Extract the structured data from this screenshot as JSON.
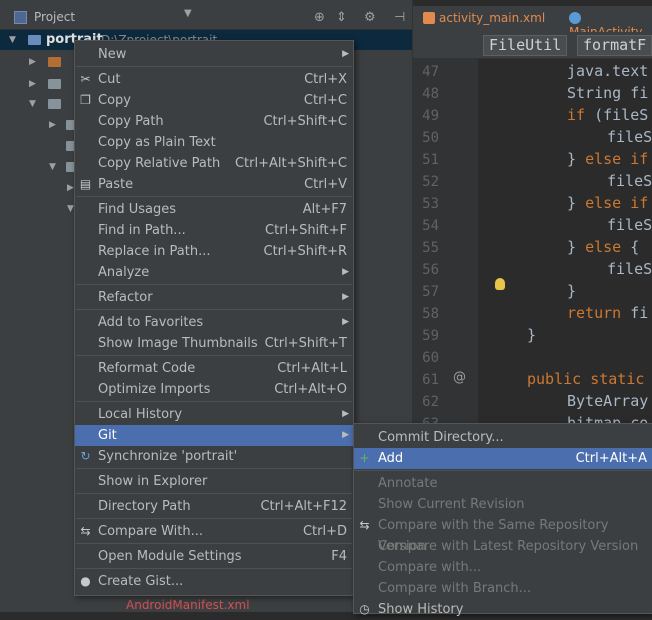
{
  "project_panel": {
    "title": "Project",
    "root": {
      "name": "portrait",
      "path": "D:\\Zproject\\portrait"
    },
    "manifest_file": "AndroidManifest.xml"
  },
  "editor": {
    "tabs": [
      {
        "label": "activity_main.xml",
        "color": "#e08b4d"
      },
      {
        "label": "MainActivity",
        "color": "#5b9bd5"
      }
    ],
    "breadcrumbs": [
      "FileUtil",
      "formatF"
    ],
    "lines": [
      {
        "num": "47",
        "indent": 1,
        "text": "java.text"
      },
      {
        "num": "48",
        "indent": 1,
        "text": "String fi"
      },
      {
        "num": "49",
        "indent": 1,
        "kw": "if",
        "text": " (fileS"
      },
      {
        "num": "50",
        "indent": 2,
        "text": "fileS"
      },
      {
        "num": "51",
        "indent": 1,
        "text": "} ",
        "kw2": "else if"
      },
      {
        "num": "52",
        "indent": 2,
        "text": "fileS"
      },
      {
        "num": "53",
        "indent": 1,
        "text": "} ",
        "kw2": "else if"
      },
      {
        "num": "54",
        "indent": 2,
        "text": "fileS"
      },
      {
        "num": "55",
        "indent": 1,
        "text": "} ",
        "kw2": "else",
        "text2": " {"
      },
      {
        "num": "56",
        "indent": 2,
        "text": "fileS"
      },
      {
        "num": "57",
        "indent": 1,
        "text": "}"
      },
      {
        "num": "58",
        "indent": 1,
        "kw": "return",
        "text": " fi"
      },
      {
        "num": "59",
        "indent": 0,
        "text": "}"
      },
      {
        "num": "60",
        "indent": 0,
        "text": ""
      },
      {
        "num": "61",
        "indent": -1,
        "kw": "public static",
        "text": ""
      },
      {
        "num": "62",
        "indent": 1,
        "text": "ByteArray"
      },
      {
        "num": "63",
        "indent": 1,
        "text": "bitmap.co"
      }
    ]
  },
  "context_menu": {
    "items": [
      {
        "label": "New",
        "shortcut": "",
        "submenu": true
      },
      {
        "sep": true
      },
      {
        "label": "Cut",
        "shortcut": "Ctrl+X",
        "icon": "cut-icon",
        "glyph": "✂"
      },
      {
        "label": "Copy",
        "shortcut": "Ctrl+C",
        "icon": "copy-icon",
        "glyph": "❐"
      },
      {
        "label": "Copy Path",
        "shortcut": "Ctrl+Shift+C"
      },
      {
        "label": "Copy as Plain Text",
        "shortcut": ""
      },
      {
        "label": "Copy Relative Path",
        "shortcut": "Ctrl+Alt+Shift+C"
      },
      {
        "label": "Paste",
        "shortcut": "Ctrl+V",
        "icon": "paste-icon",
        "glyph": "▤"
      },
      {
        "sep": true
      },
      {
        "label": "Find Usages",
        "shortcut": "Alt+F7"
      },
      {
        "label": "Find in Path...",
        "shortcut": "Ctrl+Shift+F"
      },
      {
        "label": "Replace in Path...",
        "shortcut": "Ctrl+Shift+R"
      },
      {
        "label": "Analyze",
        "shortcut": "",
        "submenu": true
      },
      {
        "sep": true
      },
      {
        "label": "Refactor",
        "shortcut": "",
        "submenu": true
      },
      {
        "sep": true
      },
      {
        "label": "Add to Favorites",
        "shortcut": "",
        "submenu": true
      },
      {
        "label": "Show Image Thumbnails",
        "shortcut": "Ctrl+Shift+T"
      },
      {
        "sep": true
      },
      {
        "label": "Reformat Code",
        "shortcut": "Ctrl+Alt+L"
      },
      {
        "label": "Optimize Imports",
        "shortcut": "Ctrl+Alt+O"
      },
      {
        "sep": true
      },
      {
        "label": "Local History",
        "shortcut": "",
        "submenu": true
      },
      {
        "label": "Git",
        "shortcut": "",
        "submenu": true,
        "selected": true
      },
      {
        "label": "Synchronize 'portrait'",
        "shortcut": "",
        "icon": "sync-icon",
        "glyph": "↻"
      },
      {
        "sep": true
      },
      {
        "label": "Show in Explorer",
        "shortcut": ""
      },
      {
        "sep": true
      },
      {
        "label": "Directory Path",
        "shortcut": "Ctrl+Alt+F12"
      },
      {
        "sep": true
      },
      {
        "label": "Compare With...",
        "shortcut": "Ctrl+D",
        "icon": "compare-icon",
        "glyph": "⇆"
      },
      {
        "sep": true
      },
      {
        "label": "Open Module Settings",
        "shortcut": "F4"
      },
      {
        "sep": true
      },
      {
        "label": "Create Gist...",
        "shortcut": "",
        "icon": "github-icon",
        "glyph": "●"
      }
    ]
  },
  "git_submenu": {
    "items": [
      {
        "label": "Commit Directory...",
        "shortcut": ""
      },
      {
        "label": "Add",
        "shortcut": "Ctrl+Alt+A",
        "selected": true,
        "icon": "add-icon",
        "glyph": "+"
      },
      {
        "sep": true
      },
      {
        "label": "Annotate",
        "shortcut": "",
        "disabled": true
      },
      {
        "label": "Show Current Revision",
        "shortcut": "",
        "disabled": true
      },
      {
        "label": "Compare with the Same Repository Version",
        "shortcut": "",
        "disabled": true,
        "icon": "compare-icon",
        "glyph": "⇆"
      },
      {
        "label": "Compare with Latest Repository Version",
        "shortcut": "",
        "disabled": true
      },
      {
        "label": "Compare with...",
        "shortcut": "",
        "disabled": true
      },
      {
        "label": "Compare with Branch...",
        "shortcut": "",
        "disabled": true
      },
      {
        "label": "Show History",
        "shortcut": "",
        "icon": "history-icon",
        "glyph": "◷"
      }
    ]
  }
}
